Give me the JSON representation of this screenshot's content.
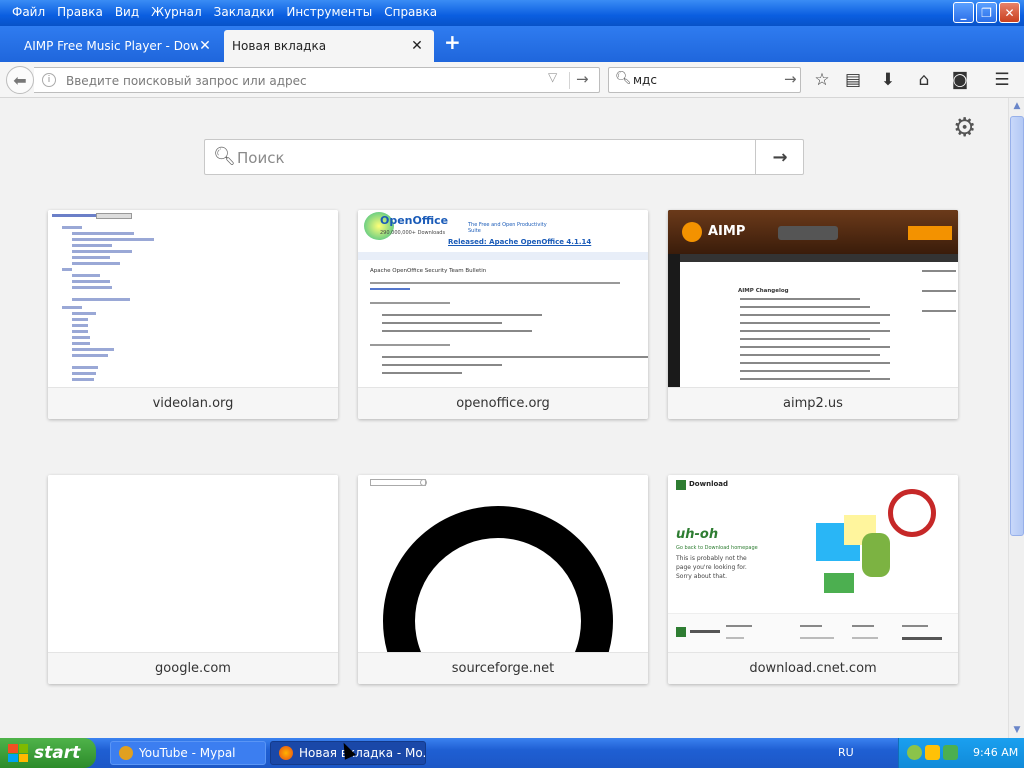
{
  "menu": [
    "Файл",
    "Правка",
    "Вид",
    "Журнал",
    "Закладки",
    "Инструменты",
    "Справка"
  ],
  "tabs": [
    {
      "label": "AIMP Free Music Player - Downloads",
      "close": "✕"
    },
    {
      "label": "Новая вкладка",
      "close": "✕"
    }
  ],
  "new_tab": "+",
  "urlbar": {
    "placeholder": "Введите поисковый запрос или адрес",
    "info": "i"
  },
  "searchbar": {
    "value": "мдс"
  },
  "newtab_page": {
    "search_placeholder": "Поиск"
  },
  "tiles": [
    {
      "label": "videolan.org"
    },
    {
      "label": "openoffice.org"
    },
    {
      "label": "aimp2.us"
    },
    {
      "label": "google.com"
    },
    {
      "label": "sourceforge.net"
    },
    {
      "label": "download.cnet.com"
    }
  ],
  "thumb_text": {
    "openoffice_logo": "OpenOffice",
    "openoffice_downloads": "290,000,000+ Downloads",
    "openoffice_tagline": "The Free and Open Productivity Suite",
    "openoffice_release": "Released: Apache OpenOffice 4.1.14",
    "openoffice_heading": "Apache OpenOffice Security Team Bulletin",
    "aimp_logo": "AIMP",
    "aimp_heading": "AIMP Changelog",
    "cnet_logo": "Download",
    "cnet_title": "uh-oh",
    "cnet_link": "Go back to Download homepage",
    "cnet_msg": "This is probably not the page you're looking for. Sorry about that."
  },
  "taskbar": {
    "start": "start",
    "tasks": [
      "YouTube - Mypal",
      "Новая вкладка - Mo..."
    ],
    "lang": "RU",
    "clock": "9:46 AM"
  },
  "colors": {
    "titlebar": "#0a5ee0",
    "taskbar": "#1f5fd3",
    "start": "#2c8b2a"
  }
}
